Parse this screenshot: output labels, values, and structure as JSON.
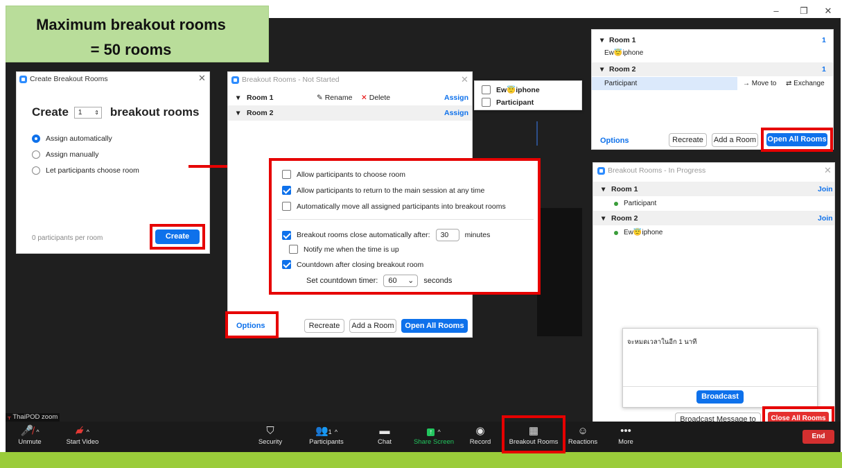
{
  "header": {
    "line1": "Maximum breakout rooms",
    "line2": "= 50 rooms"
  },
  "window_controls": {
    "minimize": "–",
    "restore": "❐",
    "close": "✕"
  },
  "create_dialog": {
    "title": "Create Breakout Rooms",
    "create_label": "Create",
    "count": "1",
    "suffix": "breakout rooms",
    "options": [
      "Assign automatically",
      "Assign manually",
      "Let participants choose room"
    ],
    "selected_option": 0,
    "participants_per_room": "0 participants per room",
    "create_button": "Create"
  },
  "not_started_dialog": {
    "title": "Breakout Rooms - Not Started",
    "rooms": [
      {
        "name": "Room 1",
        "rename": "Rename",
        "delete": "Delete",
        "assign": "Assign"
      },
      {
        "name": "Room 2",
        "assign": "Assign"
      }
    ],
    "assign_popup": [
      "Ew😇iphone",
      "Participant"
    ],
    "options_link": "Options",
    "recreate": "Recreate",
    "add_room": "Add a Room",
    "open_all": "Open All Rooms"
  },
  "options_panel": {
    "allow_choose": "Allow participants to choose room",
    "allow_return": "Allow participants to return to the main session at any time",
    "auto_move": "Automatically move all assigned participants into breakout rooms",
    "close_auto": "Breakout rooms close automatically after:",
    "close_minutes": "30",
    "minutes_label": "minutes",
    "notify": "Notify me when the time is up",
    "countdown": "Countdown after closing breakout room",
    "set_countdown": "Set countdown timer:",
    "countdown_value": "60",
    "seconds_label": "seconds",
    "checked": {
      "allow_choose": false,
      "allow_return": true,
      "auto_move": false,
      "close_auto": true,
      "notify": false,
      "countdown": true
    }
  },
  "assigned_dialog": {
    "rooms": [
      {
        "name": "Room 1",
        "count": "1",
        "members": [
          "Ew😇iphone"
        ]
      },
      {
        "name": "Room 2",
        "count": "1",
        "members": [
          "Participant"
        ]
      }
    ],
    "move_to": "Move to",
    "exchange": "Exchange",
    "options_link": "Options",
    "recreate": "Recreate",
    "add_room": "Add a Room",
    "open_all": "Open All Rooms"
  },
  "in_progress_dialog": {
    "title": "Breakout Rooms - In Progress",
    "rooms": [
      {
        "name": "Room 1",
        "join": "Join",
        "members": [
          "Participant"
        ]
      },
      {
        "name": "Room 2",
        "join": "Join",
        "members": [
          "Ew😇iphone"
        ]
      }
    ],
    "broadcast_text": "จะหมดเวลาในอีก 1 นาที",
    "broadcast_button": "Broadcast",
    "broadcast_all": "Broadcast Message to All",
    "close_all": "Close All Rooms"
  },
  "toolbar": {
    "name_tag": "ThaiPOD zoom",
    "unmute": "Unmute",
    "start_video": "Start Video",
    "security": "Security",
    "participants": "Participants",
    "participants_count": "1",
    "chat": "Chat",
    "share_screen": "Share Screen",
    "record": "Record",
    "breakout_rooms": "Breakout Rooms",
    "reactions": "Reactions",
    "more": "More",
    "end": "End"
  },
  "colors": {
    "accent": "#0e71eb",
    "highlight": "#e60000",
    "share": "#22c55e",
    "banner": "#b9dd9a",
    "footer": "#9acc3a"
  }
}
